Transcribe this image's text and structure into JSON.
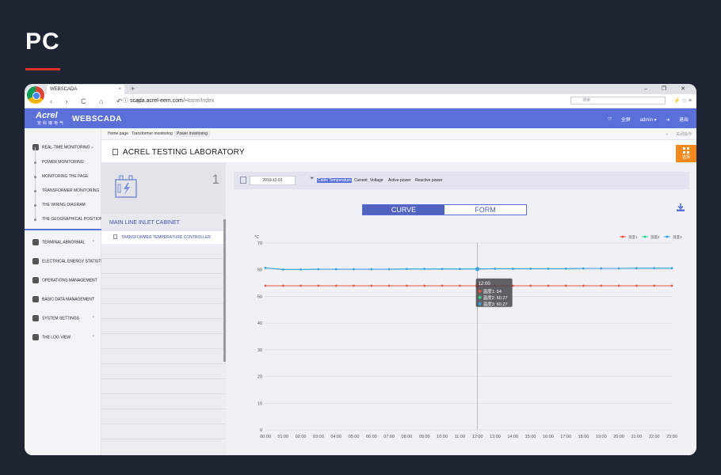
{
  "page": {
    "heading": "PC"
  },
  "browser": {
    "tab_title": "WEBSCADA",
    "tab_close": "×",
    "new_tab": "+",
    "window_controls": "– ❐ ✕",
    "nav": "‹ › C ⌂ ↶ ☆",
    "url_host": "scada.acrel-eem.com",
    "url_path": "/Home/Index",
    "search_placeholder": "搜索",
    "menu": "⚡ ☆ ≡"
  },
  "app": {
    "brand": "Acrel",
    "brand_sub": "安科瑞电气",
    "name": "WEBSCADA",
    "fullscreen": "全屏",
    "user": "admin ▾",
    "logout": "退出"
  },
  "sidebar": {
    "groups": [
      {
        "label": "REAL-TIME MONITORING",
        "expanded": true
      },
      {
        "label": "TERMINAL ABNORMAL"
      },
      {
        "label": "ELECTRICAL ENERGY STATISTICS"
      },
      {
        "label": "OPERATIONS MANAGEMENT"
      },
      {
        "label": "BASIC DATA MANAGEMENT"
      },
      {
        "label": "SYSTEM SETTINGS"
      },
      {
        "label": "THE LOG VIEW"
      }
    ],
    "subitems": [
      {
        "label": "POWER MONITORING"
      },
      {
        "label": "MONITORING THE PAGE"
      },
      {
        "label": "TRANSFORMER MONITORING"
      },
      {
        "label": "THE WIRING DIAGRAM"
      },
      {
        "label": "THE GEOGRAPHICAL POSITION"
      }
    ]
  },
  "crumbs": {
    "items": [
      "Home page",
      "Transformer monitoring",
      "Power monitoring"
    ],
    "close_ops": "关闭操作"
  },
  "main": {
    "title": "ACREL TESTING LABORATORY",
    "options_label": "选择",
    "device_count": "1",
    "cabinet_title": "MAIN LINE INLET CABINET",
    "cabinet_item": "TRANSFORMER TEMPERATURE CONTROLLER"
  },
  "filter": {
    "date": "2019-11-01",
    "metrics": [
      "Cable Temperature",
      "Current",
      "Voltage",
      "Active power",
      "Reactive power"
    ],
    "active_metric": 0
  },
  "view_toggle": {
    "curve": "CURVE",
    "form": "FORM",
    "active": "curve"
  },
  "colors": {
    "accent": "#5b6fd9",
    "series1": "#e8553b",
    "series2": "#2ecf8b",
    "series3": "#3d9fe0"
  },
  "chart_data": {
    "type": "line",
    "ylabel": "℃",
    "ylim": [
      0,
      70
    ],
    "yticks": [
      0,
      10,
      20,
      30,
      40,
      50,
      60,
      70
    ],
    "grid": true,
    "legend": "top-right",
    "categories": [
      "00:00",
      "01:00",
      "02:00",
      "03:00",
      "04:00",
      "05:00",
      "06:00",
      "07:00",
      "08:00",
      "09:00",
      "10:00",
      "11:00",
      "12:00",
      "13:00",
      "14:00",
      "15:00",
      "16:00",
      "17:00",
      "18:00",
      "19:00",
      "20:00",
      "21:00",
      "22:00",
      "23:00"
    ],
    "series": [
      {
        "name": "温度1",
        "color": "#e8553b",
        "values": [
          54,
          54,
          54,
          54,
          54,
          54,
          54,
          54,
          54,
          54,
          54,
          54,
          54,
          54,
          54,
          54,
          54,
          54,
          54,
          54,
          54,
          54,
          54,
          54
        ]
      },
      {
        "name": "温度2",
        "color": "#2ecf8b",
        "values": [
          60.7,
          60.1,
          60.1,
          60.2,
          60.2,
          60.2,
          60.2,
          60.2,
          60.3,
          60.3,
          60.3,
          60.3,
          60.27,
          60.4,
          60.4,
          60.4,
          60.4,
          60.4,
          60.5,
          60.5,
          60.5,
          60.6,
          60.6,
          60.6
        ]
      },
      {
        "name": "温度3",
        "color": "#3d9fe0",
        "values": [
          60.7,
          60.1,
          60.1,
          60.2,
          60.2,
          60.2,
          60.2,
          60.2,
          60.3,
          60.3,
          60.3,
          60.3,
          60.27,
          60.4,
          60.4,
          60.4,
          60.4,
          60.4,
          60.5,
          60.5,
          60.5,
          60.6,
          60.6,
          60.6
        ]
      }
    ],
    "tooltip": {
      "index": 12,
      "title": "12:00",
      "rows": [
        "温度1: 54",
        "温度2: 60.27",
        "温度3: 60.27"
      ]
    }
  }
}
